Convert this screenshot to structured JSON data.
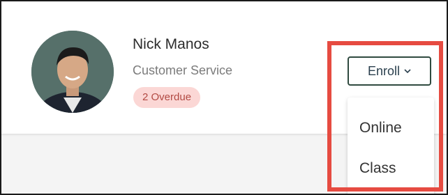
{
  "employee": {
    "name": "Nick Manos",
    "role": "Customer Service",
    "badge": "2 Overdue"
  },
  "enroll": {
    "button_label": "Enroll",
    "button_icon": "chevron-down-icon",
    "options": [
      "Online",
      "Class"
    ]
  },
  "colors": {
    "badge_bg": "#fbd7d5",
    "badge_text": "#b24a43",
    "button_border": "#2f4a3f",
    "highlight": "#e64b41"
  }
}
